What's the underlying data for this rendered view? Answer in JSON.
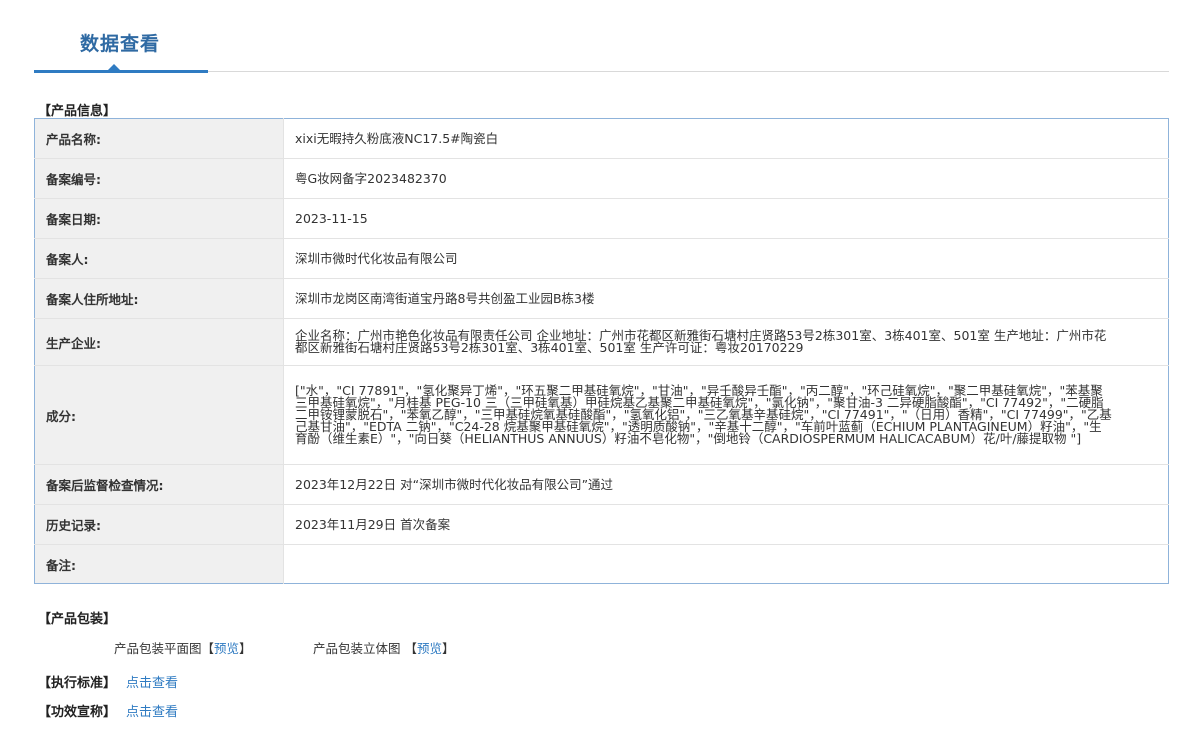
{
  "header": {
    "title": "数据查看"
  },
  "product_info": {
    "section_title": "【产品信息】",
    "rows": [
      {
        "key": "产品名称:",
        "value": "xixi无暇持久粉底液NC17.5#陶瓷白"
      },
      {
        "key": "备案编号:",
        "value": "粤G妆网备字2023482370"
      },
      {
        "key": "备案日期:",
        "value": "2023-11-15"
      },
      {
        "key": "备案人:",
        "value": "深圳市微时代化妆品有限公司"
      },
      {
        "key": "备案人住所地址:",
        "value": "深圳市龙岗区南湾街道宝丹路8号共创盈工业园B栋3楼"
      },
      {
        "key": "生产企业:",
        "value": "企业名称：广州市艳色化妆品有限责任公司 企业地址：广州市花都区新雅街石塘村庄贤路53号2栋301室、3栋401室、501室 生产地址：广州市花都区新雅街石塘村庄贤路53号2栋301室、3栋401室、501室 生产许可证：粤妆20170229"
      },
      {
        "key": "成分:",
        "value": "[\"水\"，\"CI 77891\"，\"氢化聚异丁烯\"，\"环五聚二甲基硅氧烷\"，\"甘油\"，\"异壬酸异壬酯\"，\"丙二醇\"，\"环己硅氧烷\"，\"聚二甲基硅氧烷\"，\"苯基聚三甲基硅氧烷\"，\"月桂基 PEG-10 三（三甲硅氧基）甲硅烷基乙基聚二甲基硅氧烷\"，\"氯化钠\"，\"聚甘油-3 二异硬脂酸酯\"，\"CI 77492\"，\"二硬脂二甲铵锂蒙脱石\"，\"苯氧乙醇\"，\"三甲基硅烷氧基硅酸酯\"，\"氢氧化铝\"，\"三乙氧基辛基硅烷\"，\"CI 77491\"，\"（日用）香精\"，\"CI 77499\"，\"乙基己基甘油\"，\"EDTA 二钠\"，\"C24-28 烷基聚甲基硅氧烷\"，\"透明质酸钠\"，\"辛基十二醇\"，\"车前叶蓝蓟（ECHIUM PLANTAGINEUM）籽油\"，\"生育酚（维生素E）\"，\"向日葵（HELIANTHUS ANNUUS）籽油不皂化物\"，\"倒地铃（CARDIOSPERMUM HALICACABUM）花/叶/藤提取物 \"]"
      },
      {
        "key": "备案后监督检查情况:",
        "value": "2023年12月22日 对“深圳市微时代化妆品有限公司”通过"
      },
      {
        "key": "历史记录:",
        "value": "2023年11月29日 首次备案"
      },
      {
        "key": "备注:",
        "value": ""
      }
    ]
  },
  "packaging": {
    "section_title": "【产品包装】",
    "flat_label": "产品包装平面图",
    "flat_preview": "预览",
    "solid_label": "产品包装立体图",
    "solid_preview": "预览",
    "bracket_open": "【",
    "bracket_close": "】"
  },
  "standard": {
    "title": "【执行标准】",
    "link": "点击查看"
  },
  "efficacy": {
    "title": "【功效宣称】",
    "link": "点击查看"
  }
}
